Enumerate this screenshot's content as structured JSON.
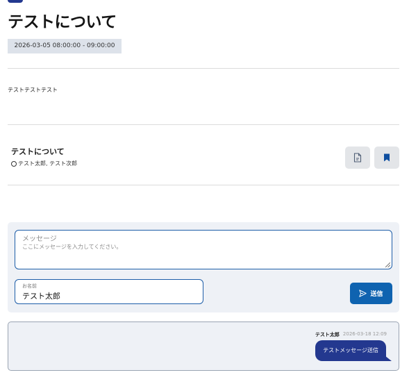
{
  "post": {
    "title": "テストについて",
    "datetime": "2026-03-05 08:00:00 - 09:00:00",
    "description": "テストテストテスト"
  },
  "item": {
    "title": "テストについて",
    "people": "テスト太郎, テスト次郎",
    "actions": [
      {
        "icon": "document-icon"
      },
      {
        "icon": "bookmark-icon"
      }
    ]
  },
  "form": {
    "message_label": "メッセージ",
    "message_placeholder": "ここにメッセージを入力してください。",
    "name_label": "お名前",
    "name_value": "テスト太郎",
    "send_label": "送信"
  },
  "chat": {
    "messages": [
      {
        "author": "テスト太郎",
        "time": "2026-03-18 12:09",
        "text": "テストメッセージ送信"
      }
    ]
  },
  "colors": {
    "accent": "#0f63b0",
    "bubble": "#23388f",
    "panel": "#eef1f6"
  }
}
